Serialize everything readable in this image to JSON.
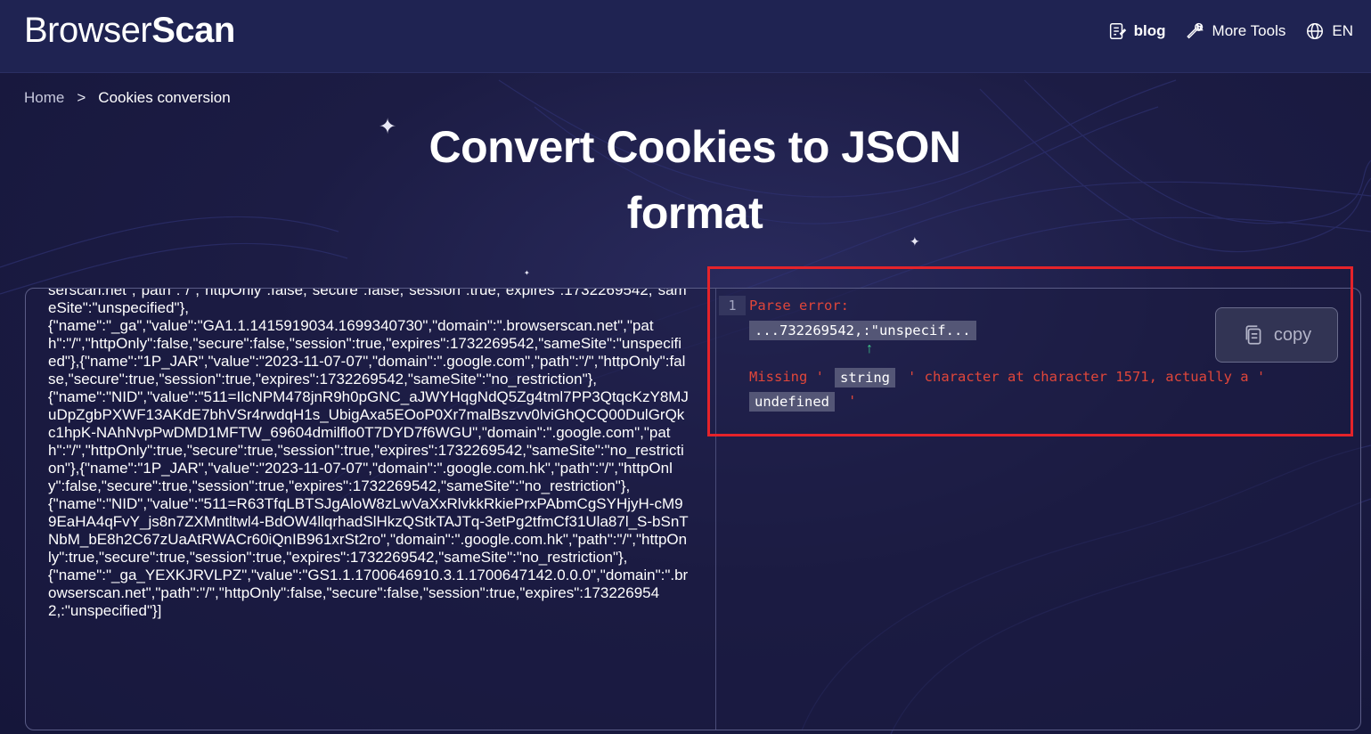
{
  "header": {
    "logo_regular": "Browser",
    "logo_bold": "Scan",
    "nav": {
      "blog_label": "blog",
      "tools_label": "More Tools",
      "lang_label": "EN"
    }
  },
  "breadcrumb": {
    "home": "Home",
    "separator": ">",
    "current": "Cookies conversion"
  },
  "page": {
    "title": "Convert Cookies to JSON format"
  },
  "input": {
    "text": "serscan.net\",\"path\":\"/\",\"httpOnly\":false,\"secure\":false,\"session\":true,\"expires\":1732269542,\"sameSite\":\"unspecified\"},\n{\"name\":\"_ga\",\"value\":\"GA1.1.1415919034.1699340730\",\"domain\":\".browserscan.net\",\"path\":\"/\",\"httpOnly\":false,\"secure\":false,\"session\":true,\"expires\":1732269542,\"sameSite\":\"unspecified\"},{\"name\":\"1P_JAR\",\"value\":\"2023-11-07-07\",\"domain\":\".google.com\",\"path\":\"/\",\"httpOnly\":false,\"secure\":true,\"session\":true,\"expires\":1732269542,\"sameSite\":\"no_restriction\"},\n{\"name\":\"NID\",\"value\":\"511=IlcNPM478jnR9h0pGNC_aJWYHqgNdQ5Zg4tml7PP3QtqcKzY8MJuDpZgbPXWF13AKdE7bhVSr4rwdqH1s_UbigAxa5EOoP0Xr7malBszvv0lviGhQCQ00DulGrQkc1hpK-NAhNvpPwDMD1MFTW_69604dmilflo0T7DYD7f6WGU\",\"domain\":\".google.com\",\"path\":\"/\",\"httpOnly\":true,\"secure\":true,\"session\":true,\"expires\":1732269542,\"sameSite\":\"no_restriction\"},{\"name\":\"1P_JAR\",\"value\":\"2023-11-07-07\",\"domain\":\".google.com.hk\",\"path\":\"/\",\"httpOnly\":false,\"secure\":true,\"session\":true,\"expires\":1732269542,\"sameSite\":\"no_restriction\"},\n{\"name\":\"NID\",\"value\":\"511=R63TfqLBTSJgAloW8zLwVaXxRlvkkRkiePrxPAbmCgSYHjyH-cM99EaHA4qFvY_js8n7ZXMntltwl4-BdOW4llqrhadSlHkzQStkTAJTq-3etPg2tfmCf31Ula87l_S-bSnTNbM_bE8h2C67zUaAtRWACr60iQnIB961xrSt2ro\",\"domain\":\".google.com.hk\",\"path\":\"/\",\"httpOnly\":true,\"secure\":true,\"session\":true,\"expires\":1732269542,\"sameSite\":\"no_restriction\"},\n{\"name\":\"_ga_YEXKJRVLPZ\",\"value\":\"GS1.1.1700646910.3.1.1700647142.0.0.0\",\"domain\":\".browserscan.net\",\"path\":\"/\",\"httpOnly\":false,\"secure\":false,\"session\":true,\"expires\":1732269542,:\"unspecified\"}]"
  },
  "output": {
    "line_number": "1",
    "parse_error_label": "Parse error:",
    "error_snippet": "...732269542,:\"unspecif...",
    "arrow": "↑",
    "missing_prefix": "Missing '",
    "missing_token": "string",
    "missing_middle": "' character at character 1571, actually a '",
    "actual_token": "undefined",
    "missing_suffix": "'",
    "copy_label": "copy"
  },
  "colors": {
    "error_text": "#e0463a",
    "highlight_border": "#e5232a",
    "arrow": "#40d090"
  }
}
